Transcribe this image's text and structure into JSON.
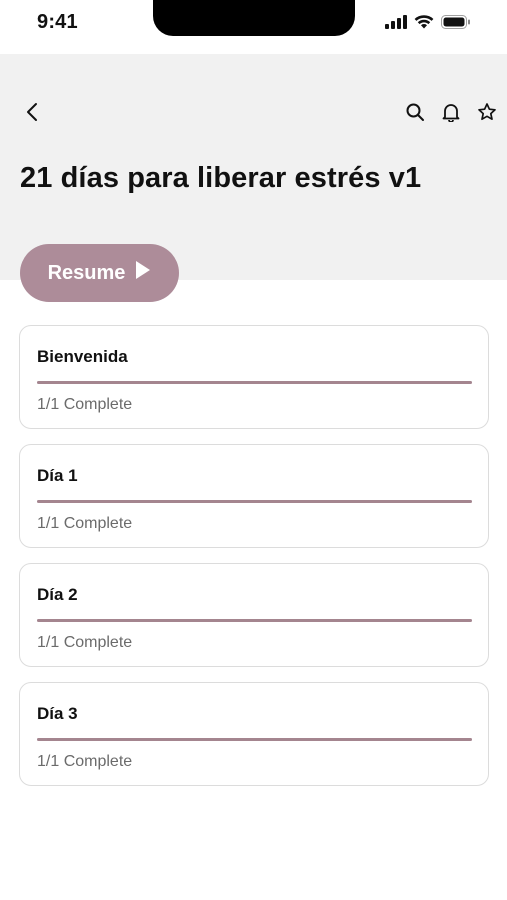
{
  "status_bar": {
    "time": "9:41"
  },
  "header": {
    "title": "21 días para liberar estrés v1",
    "icons": [
      "back-icon",
      "search-icon",
      "bell-icon",
      "star-icon"
    ]
  },
  "resume": {
    "label": "Resume"
  },
  "colors": {
    "accent": "#ad8c99",
    "progress": "#a4858f",
    "header_bg": "#f1f1f1"
  },
  "modules": [
    {
      "title": "Bienvenida",
      "status": "1/1 Complete",
      "progress": 1.0
    },
    {
      "title": "Día 1",
      "status": "1/1 Complete",
      "progress": 1.0
    },
    {
      "title": "Día 2",
      "status": "1/1 Complete",
      "progress": 1.0
    },
    {
      "title": "Día 3",
      "status": "1/1 Complete",
      "progress": 1.0
    }
  ]
}
